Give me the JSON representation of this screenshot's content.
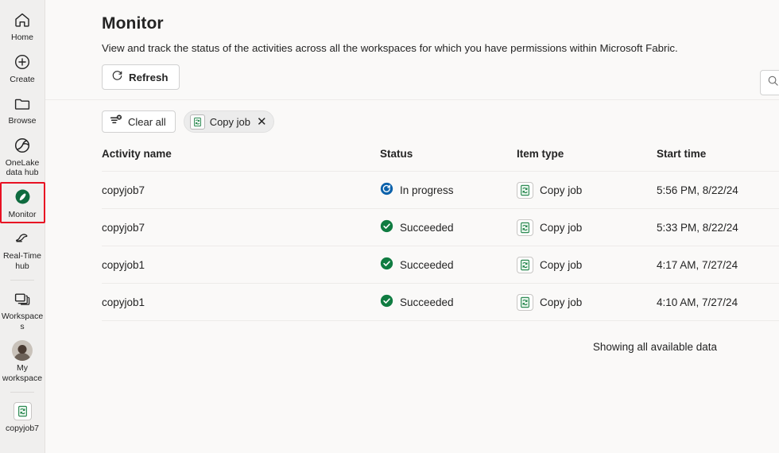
{
  "sidebar": {
    "items": [
      {
        "label": "Home",
        "icon": "home-icon",
        "selected": false,
        "divider_after": false
      },
      {
        "label": "Create",
        "icon": "plus-circle-icon",
        "selected": false,
        "divider_after": false
      },
      {
        "label": "Browse",
        "icon": "folder-icon",
        "selected": false,
        "divider_after": false
      },
      {
        "label": "OneLake data hub",
        "icon": "onelake-icon",
        "selected": false,
        "divider_after": false
      },
      {
        "label": "Monitor",
        "icon": "monitor-icon",
        "selected": true,
        "divider_after": false
      },
      {
        "label": "Real-Time hub",
        "icon": "realtime-hub-icon",
        "selected": false,
        "divider_after": true
      },
      {
        "label": "Workspaces",
        "icon": "workspaces-icon",
        "selected": false,
        "divider_after": false
      },
      {
        "label": "My workspace",
        "icon": "avatar",
        "selected": false,
        "divider_after": true
      },
      {
        "label": "copyjob7",
        "icon": "copy-job-icon",
        "selected": false,
        "divider_after": false
      }
    ],
    "selection_outline_color": "#e81123",
    "background_color": "#f0efee"
  },
  "header": {
    "title": "Monitor",
    "subtitle": "View and track the status of the activities across all the workspaces for which you have permissions within Microsoft Fabric."
  },
  "toolbar": {
    "refresh_label": "Refresh",
    "refresh_icon": "refresh-icon",
    "right_button_icon": "search-icon"
  },
  "filters": {
    "clear_all_label": "Clear all",
    "clear_all_icon": "clear-filter-icon",
    "chips": [
      {
        "label": "Copy job",
        "icon": "copy-job-icon",
        "close_icon": "close-icon"
      }
    ]
  },
  "table": {
    "columns": [
      "Activity name",
      "Status",
      "Item type",
      "Start time"
    ],
    "rows": [
      {
        "activity_name": "copyjob7",
        "status": "In progress",
        "status_kind": "inprogress",
        "item_type": "Copy job",
        "start_time": "5:56 PM, 8/22/24"
      },
      {
        "activity_name": "copyjob7",
        "status": "Succeeded",
        "status_kind": "succeeded",
        "item_type": "Copy job",
        "start_time": "5:33 PM, 8/22/24"
      },
      {
        "activity_name": "copyjob1",
        "status": "Succeeded",
        "status_kind": "succeeded",
        "item_type": "Copy job",
        "start_time": "4:17 AM, 7/27/24"
      },
      {
        "activity_name": "copyjob1",
        "status": "Succeeded",
        "status_kind": "succeeded",
        "item_type": "Copy job",
        "start_time": "4:10 AM, 7/27/24"
      }
    ]
  },
  "footer": {
    "note": "Showing all available data"
  },
  "colors": {
    "status_inprogress": "#0d62ab",
    "status_succeeded": "#107c41",
    "accent_green": "#0f7b3e",
    "selection_red": "#e81123",
    "sidebar_bg": "#f0efee",
    "main_bg": "#faf9f8"
  }
}
